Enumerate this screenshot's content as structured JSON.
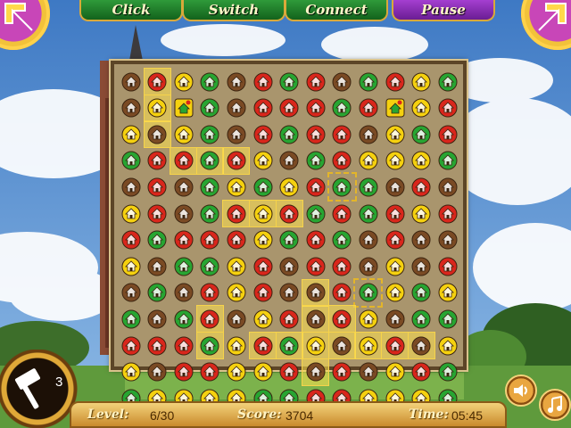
{
  "tabs": [
    {
      "label": "Click",
      "color": "green"
    },
    {
      "label": "Switch",
      "color": "green"
    },
    {
      "label": "Connect",
      "color": "green"
    },
    {
      "label": "Pause",
      "color": "purple"
    }
  ],
  "corner_buttons": {
    "left": {
      "icon": "arrow-back-icon"
    },
    "right": {
      "icon": "arrow-forward-icon"
    }
  },
  "tools": {
    "hammer": {
      "icon": "hammer-icon",
      "count": "3"
    }
  },
  "status": {
    "level_label": "Level:",
    "level_value": "6/30",
    "score_label": "Score:",
    "score_value": "3704",
    "time_label": "Time:",
    "time_value": "05:45"
  },
  "controls": {
    "sound": {
      "icon": "speaker-icon"
    },
    "music": {
      "icon": "music-note-icon"
    }
  },
  "colors": {
    "R": "#d9261c",
    "Y": "#f5d10f",
    "G": "#27a532",
    "B": "#7a4a24"
  },
  "board": {
    "rows": [
      "BRYGBRGRBGRYG",
      "BYXGBRRRGRXYR",
      "YBYGBRGRRBYGR",
      "GRRGRYBGRYYYG",
      "BRBGYGYRGGBRB",
      "YRBGRYRGRGRYR",
      "RGRRRYGRGBRBB",
      "YBGGYRBRRBYBR",
      "BGBRYRBBRGYGY",
      "GBGRBYRBRYBGG",
      "RRRGYRGYBYRBY",
      "YBRRYYRBRBYRG",
      "GYYYYGGRRYYYG"
    ],
    "highlighted": [
      [
        1,
        0
      ],
      [
        1,
        1
      ],
      [
        1,
        2
      ],
      [
        2,
        3
      ],
      [
        3,
        3
      ],
      [
        4,
        3
      ],
      [
        3,
        9
      ],
      [
        3,
        10
      ],
      [
        13,
        3
      ],
      [
        14,
        3
      ],
      [
        13,
        8
      ],
      [
        14,
        8
      ],
      [
        14,
        9
      ],
      [
        4,
        5
      ],
      [
        5,
        5
      ],
      [
        6,
        5
      ],
      [
        7,
        8
      ],
      [
        7,
        9
      ],
      [
        7,
        10
      ],
      [
        7,
        11
      ],
      [
        8,
        9
      ],
      [
        5,
        10
      ],
      [
        6,
        10
      ],
      [
        7,
        10
      ],
      [
        8,
        10
      ],
      [
        9,
        10
      ],
      [
        10,
        10
      ],
      [
        11,
        10
      ]
    ],
    "selected": [
      [
        8,
        4
      ],
      [
        9,
        8
      ]
    ]
  }
}
